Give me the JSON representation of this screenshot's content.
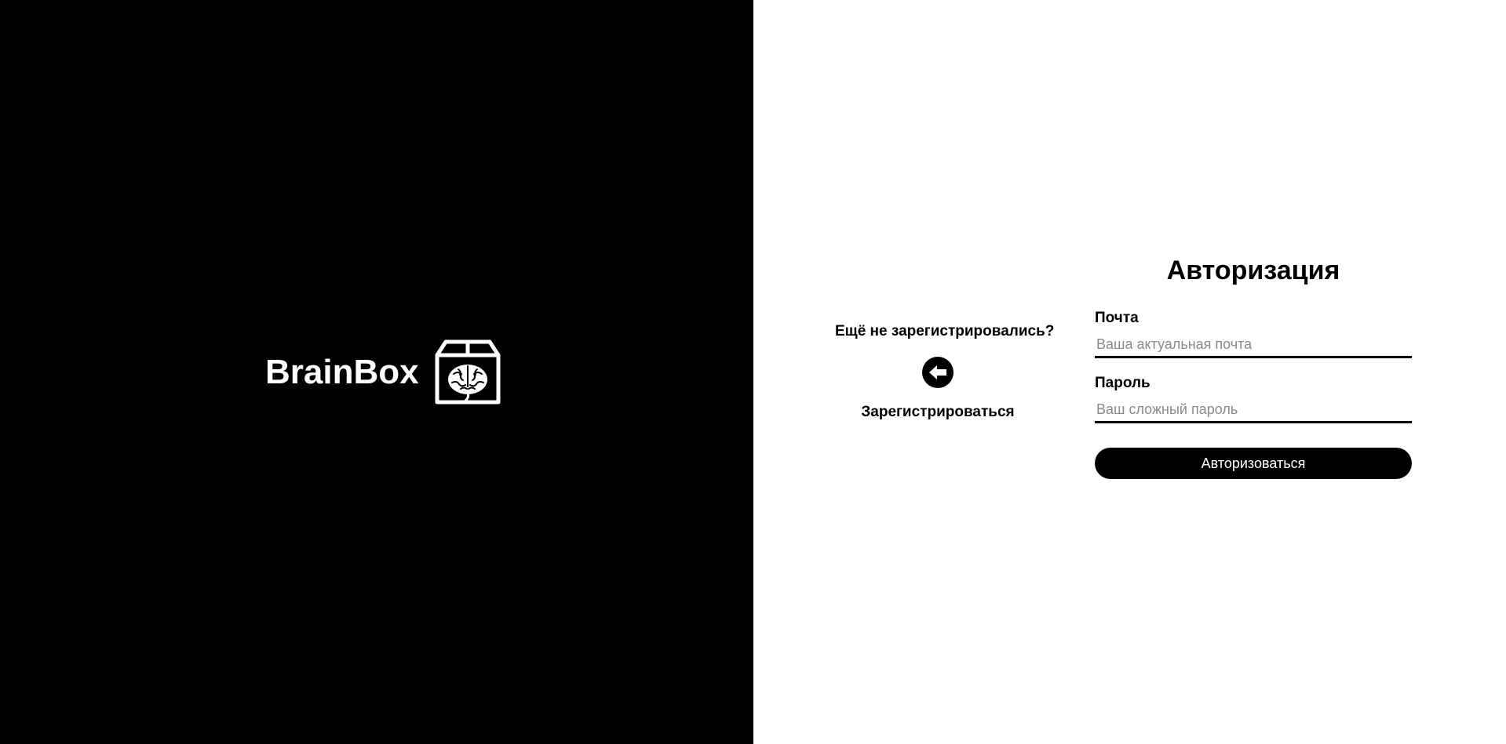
{
  "brand": {
    "name": "BrainBox",
    "logo_icon": "brain-box-icon"
  },
  "register": {
    "question": "Ещё не зарегистрировались?",
    "back_icon": "arrow-left-circle-icon",
    "link_label": "Зарегистрироваться"
  },
  "auth": {
    "title": "Авторизация",
    "email": {
      "label": "Почта",
      "placeholder": "Ваша актуальная почта",
      "value": ""
    },
    "password": {
      "label": "Пароль",
      "placeholder": "Ваш сложный пароль",
      "value": ""
    },
    "submit_label": "Авторизоваться"
  },
  "colors": {
    "left_background": "#000000",
    "right_background": "#ffffff",
    "accent": "#000000",
    "placeholder": "#8a8a8a"
  }
}
